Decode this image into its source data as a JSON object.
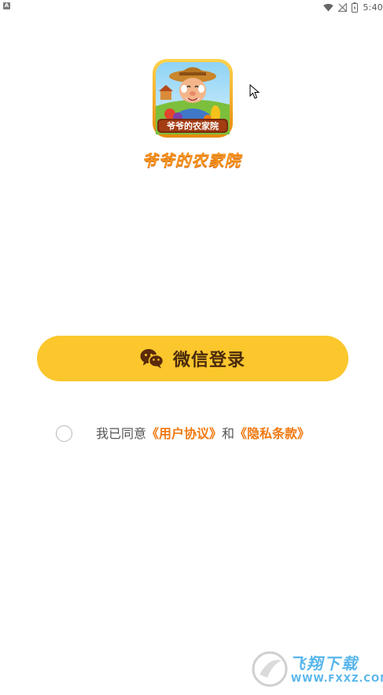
{
  "status_bar": {
    "app_icon_letter": "A",
    "time": "5:40",
    "icons": [
      "wifi-icon",
      "no-signal-icon",
      "battery-icon"
    ]
  },
  "app": {
    "logo_badge_text": "爷爷的农家院",
    "title": "爷爷的农家院"
  },
  "login": {
    "wechat_label": "微信登录",
    "accent_color": "#fbc72d"
  },
  "agreement": {
    "checked": false,
    "prefix": "我已同意",
    "user_agreement": "《用户协议》",
    "and": "和",
    "privacy": "《隐私条款》",
    "link_color": "#f07a12"
  },
  "watermark": {
    "text": "飞翔下载",
    "url": "WWW.FXXZ.COM"
  }
}
